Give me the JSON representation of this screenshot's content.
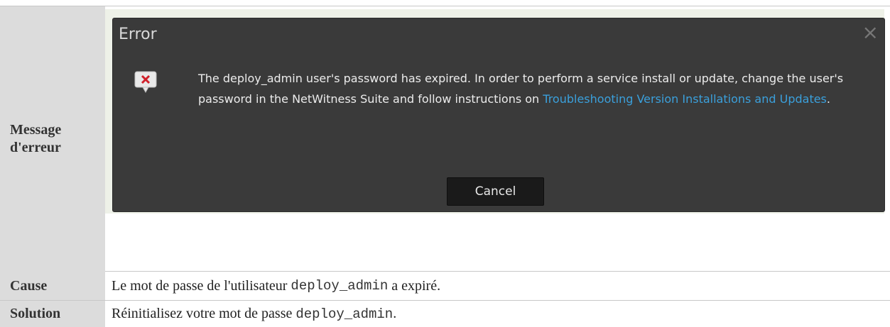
{
  "table": {
    "message_label": "Message d'erreur",
    "cause_label": "Cause",
    "solution_label": "Solution",
    "cause_text_before": "Le mot de passe de l'utilisateur ",
    "cause_code": "deploy_admin",
    "cause_text_after": " a expiré.",
    "solution_text_before": "Réinitialisez votre mot de passe ",
    "solution_code": "deploy_admin",
    "solution_text_after": "."
  },
  "dialog": {
    "title": "Error",
    "close_glyph": "×",
    "message_text": "The deploy_admin user's password has expired. In order to perform a service install or update, change the user's password in the NetWitness Suite and follow instructions on ",
    "link_text": "Troubleshooting Version Installations and Updates",
    "message_tail": ".",
    "cancel_label": "Cancel",
    "icon": "error-x-icon"
  },
  "colors": {
    "dialog_bg": "#3a3a3a",
    "link": "#3aa0dc",
    "error_red": "#d0202a",
    "label_bg": "#dcdcdc"
  }
}
